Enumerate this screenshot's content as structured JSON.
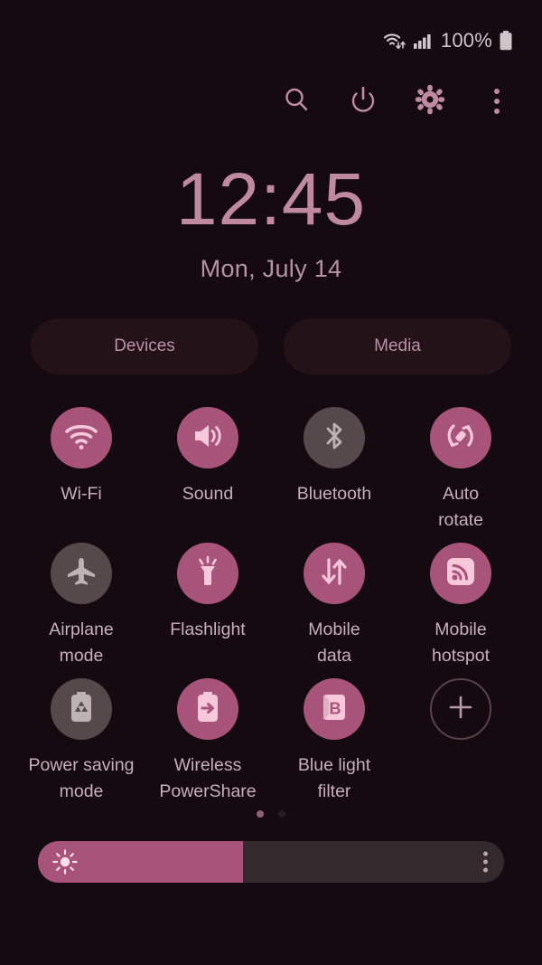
{
  "status_bar": {
    "wifi_icon": "wifi-transfer-icon",
    "signal_icon": "cellular-signal-icon",
    "battery_percent": "100%",
    "battery_icon": "battery-full-icon"
  },
  "toolbar": {
    "search_label": "search-icon",
    "power_label": "power-icon",
    "settings_label": "gear-icon",
    "more_label": "more-options-icon"
  },
  "clock": {
    "time": "12:45",
    "date": "Mon, July 14"
  },
  "chips": [
    {
      "label": "Devices"
    },
    {
      "label": "Media"
    }
  ],
  "toggles": [
    {
      "label": "Wi-Fi",
      "icon": "wifi-icon",
      "active": true
    },
    {
      "label": "Sound",
      "icon": "volume-icon",
      "active": true
    },
    {
      "label": "Bluetooth",
      "icon": "bluetooth-icon",
      "active": false
    },
    {
      "label": "Auto\nrotate",
      "icon": "auto-rotate-icon",
      "active": true
    },
    {
      "label": "Airplane\nmode",
      "icon": "airplane-icon",
      "active": false
    },
    {
      "label": "Flashlight",
      "icon": "flashlight-icon",
      "active": true
    },
    {
      "label": "Mobile\ndata",
      "icon": "mobile-data-icon",
      "active": true
    },
    {
      "label": "Mobile\nhotspot",
      "icon": "hotspot-icon",
      "active": true
    },
    {
      "label": "Power saving\nmode",
      "icon": "power-saving-icon",
      "active": false
    },
    {
      "label": "Wireless\nPowerShare",
      "icon": "power-share-icon",
      "active": true
    },
    {
      "label": "Blue light\nfilter",
      "icon": "blue-light-icon",
      "active": true
    },
    {
      "label": "",
      "icon": "add-icon",
      "active": false
    }
  ],
  "pagination": {
    "total_pages": 2,
    "current_page": 1
  },
  "brightness": {
    "value_percent": 44,
    "sun_icon": "brightness-sun-icon",
    "menu_icon": "brightness-options-icon"
  },
  "colors": {
    "background": "#150a10",
    "accent_active": "#a8547a",
    "toggle_inactive": "#56494c",
    "label_text": "#c7b0b8",
    "clock_text": "#c08a9e",
    "chip_background": "#241219",
    "slider_track": "#342a2e"
  }
}
